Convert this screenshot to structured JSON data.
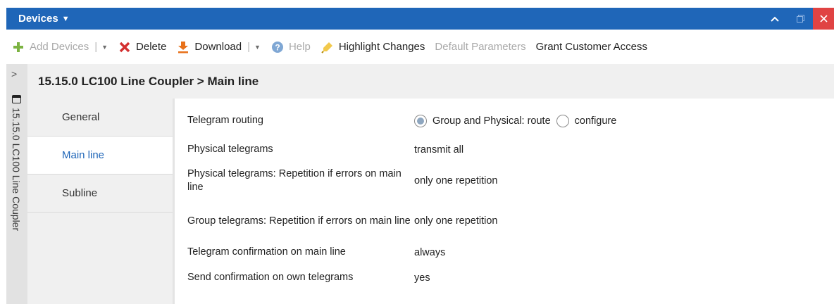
{
  "titlebar": {
    "title": "Devices"
  },
  "toolbar": {
    "add_devices": "Add Devices",
    "delete": "Delete",
    "download": "Download",
    "help": "Help",
    "highlight_changes": "Highlight Changes",
    "default_parameters": "Default Parameters",
    "grant_customer_access": "Grant Customer Access"
  },
  "side_tab": {
    "label": "15.15.0 LC100 Line Coupler"
  },
  "header": {
    "breadcrumb": "15.15.0 LC100 Line Coupler > Main line"
  },
  "nav": {
    "items": [
      {
        "label": "General"
      },
      {
        "label": "Main line"
      },
      {
        "label": "Subline"
      }
    ]
  },
  "properties": [
    {
      "label": "Telegram routing",
      "options": [
        "Group and Physical: route",
        "configure"
      ],
      "selected": "Group and Physical: route"
    },
    {
      "label": "Physical telegrams",
      "value": "transmit all"
    },
    {
      "label": "Physical telegrams: Repetition if errors on main line",
      "value": "only one repetition"
    },
    {
      "label": "Group telegrams: Repetition if errors on main line",
      "value": "only one repetition"
    },
    {
      "label": "Telegram confirmation on main line",
      "value": "always"
    },
    {
      "label": "Send confirmation on own telegrams",
      "value": "yes"
    }
  ],
  "colors": {
    "accent": "#1f66b8",
    "close": "#e04343",
    "panel": "#f0f0f0"
  }
}
